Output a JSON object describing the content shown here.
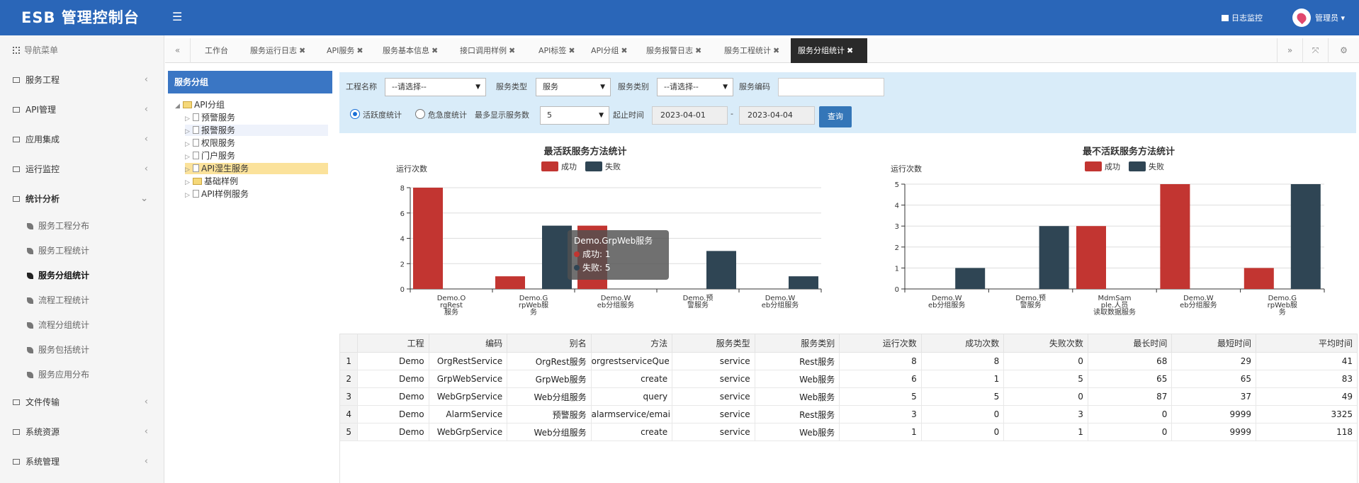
{
  "app": {
    "title": "ESB 管理控制台",
    "log_monitor": "日志监控",
    "user": "管理员 ▾"
  },
  "sidebar": {
    "header": "导航菜单",
    "items": [
      {
        "label": "服务工程"
      },
      {
        "label": "API管理"
      },
      {
        "label": "应用集成"
      },
      {
        "label": "运行监控"
      },
      {
        "label": "统计分析"
      },
      {
        "label": "文件传输"
      },
      {
        "label": "系统资源"
      },
      {
        "label": "系统管理"
      }
    ],
    "sub_items": [
      {
        "label": "服务工程分布"
      },
      {
        "label": "服务工程统计"
      },
      {
        "label": "服务分组统计"
      },
      {
        "label": "流程工程统计"
      },
      {
        "label": "流程分组统计"
      },
      {
        "label": "服务包括统计"
      },
      {
        "label": "服务应用分布"
      }
    ]
  },
  "tabs": [
    {
      "label": "工作台"
    },
    {
      "label": "服务运行日志"
    },
    {
      "label": "API服务"
    },
    {
      "label": "服务基本信息"
    },
    {
      "label": "接口调用样例"
    },
    {
      "label": "API标签"
    },
    {
      "label": "API分组"
    },
    {
      "label": "服务报警日志"
    },
    {
      "label": "服务工程统计"
    },
    {
      "label": "服务分组统计"
    }
  ],
  "tree": {
    "title": "服务分组",
    "root": "API分组",
    "children": [
      "预警服务",
      "报警服务",
      "权限服务",
      "门户服务",
      "API湿生服务",
      "基础样例",
      "API样例服务"
    ]
  },
  "filter": {
    "project_label": "工程名称",
    "project_value": "--请选择--",
    "service_type_label": "服务类型",
    "service_type_value": "服务",
    "service_category_label": "服务类别",
    "service_category_value": "--请选择--",
    "service_code_label": "服务编码",
    "radio_active": "活跃度统计",
    "radio_risk": "危急度统计",
    "max_show_label": "最多显示服务数",
    "max_show_value": "5",
    "start_label": "起止时间",
    "start_date": "2023-04-01",
    "date_sep": "-",
    "end_date": "2023-04-04",
    "query_btn": "查询"
  },
  "tooltip": {
    "title": "Demo.GrpWeb服务",
    "success": "成功: 1",
    "fail": "失败: 5"
  },
  "colors": {
    "success": "#c23531",
    "fail": "#2f4554",
    "topbar": "#2a66b8"
  },
  "chart_data": [
    {
      "type": "bar",
      "title": "最活跃服务方法统计",
      "ylabel": "运行次数",
      "ylim": [
        0,
        8
      ],
      "yticks": [
        "0",
        "2",
        "4",
        "6",
        "8"
      ],
      "categories": [
        [
          "Demo.O",
          "rgRest",
          "服务"
        ],
        [
          "Demo.G",
          "rpWeb服",
          "务"
        ],
        [
          "Demo.W",
          "eb分组服务"
        ],
        [
          "Demo.预",
          "警服务"
        ],
        [
          "Demo.W",
          "eb分组服务"
        ]
      ],
      "legend": [
        "成功",
        "失败"
      ],
      "series": [
        {
          "name": "成功",
          "values": [
            8,
            1,
            5,
            0,
            0
          ]
        },
        {
          "name": "失败",
          "values": [
            0,
            5,
            0,
            3,
            1
          ]
        }
      ]
    },
    {
      "type": "bar",
      "title": "最不活跃服务方法统计",
      "ylabel": "运行次数",
      "ylim": [
        0,
        5
      ],
      "yticks": [
        "0",
        "1",
        "2",
        "3",
        "4",
        "5"
      ],
      "categories": [
        [
          "Demo.W",
          "eb分组服务"
        ],
        [
          "Demo.预",
          "警服务"
        ],
        [
          "MdmSam",
          "ple.人员",
          "读取数据服务"
        ],
        [
          "Demo.W",
          "eb分组服务"
        ],
        [
          "Demo.G",
          "rpWeb服",
          "务"
        ]
      ],
      "legend": [
        "成功",
        "失败"
      ],
      "series": [
        {
          "name": "成功",
          "values": [
            0,
            0,
            3,
            5,
            1
          ]
        },
        {
          "name": "失败",
          "values": [
            1,
            3,
            0,
            0,
            5
          ]
        }
      ]
    }
  ],
  "table": {
    "headers": [
      "工程",
      "编码",
      "别名",
      "方法",
      "服务类型",
      "服务类别",
      "运行次数",
      "成功次数",
      "失败次数",
      "最长时间",
      "最短时间",
      "平均时间"
    ],
    "rows": [
      [
        "1",
        "Demo",
        "OrgRestService",
        "OrgRest服务",
        "orgrestserviceQue",
        "service",
        "Rest服务",
        "8",
        "8",
        "0",
        "68",
        "29",
        "41"
      ],
      [
        "2",
        "Demo",
        "GrpWebService",
        "GrpWeb服务",
        "create",
        "service",
        "Web服务",
        "6",
        "1",
        "5",
        "65",
        "65",
        "83"
      ],
      [
        "3",
        "Demo",
        "WebGrpService",
        "Web分组服务",
        "query",
        "service",
        "Web服务",
        "5",
        "5",
        "0",
        "87",
        "37",
        "49"
      ],
      [
        "4",
        "Demo",
        "AlarmService",
        "预警服务",
        "alarmservice/emai",
        "service",
        "Rest服务",
        "3",
        "0",
        "3",
        "0",
        "9999",
        "3325"
      ],
      [
        "5",
        "Demo",
        "WebGrpService",
        "Web分组服务",
        "create",
        "service",
        "Web服务",
        "1",
        "0",
        "1",
        "0",
        "9999",
        "118"
      ]
    ]
  }
}
